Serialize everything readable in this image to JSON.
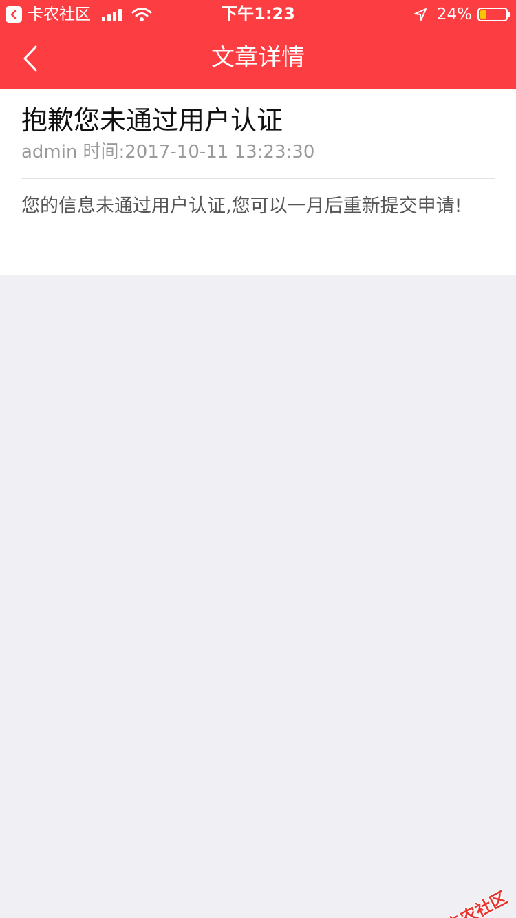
{
  "status_bar": {
    "app_name": "卡农社区",
    "time": "下午1:23",
    "battery_percent": "24%",
    "battery_level": 0.24,
    "battery_color": "#f7c600"
  },
  "nav": {
    "title": "文章详情",
    "back_icon": "chevron-left-icon",
    "background": "#fc3d41"
  },
  "article": {
    "title": "抱歉您未通过用户认证",
    "author": "admin",
    "time_label": "时间:2017-10-11 13:23:30",
    "body": "您的信息未通过用户认证,您可以一月后重新提交申请!"
  },
  "watermark": {
    "text": "卡农社区"
  }
}
